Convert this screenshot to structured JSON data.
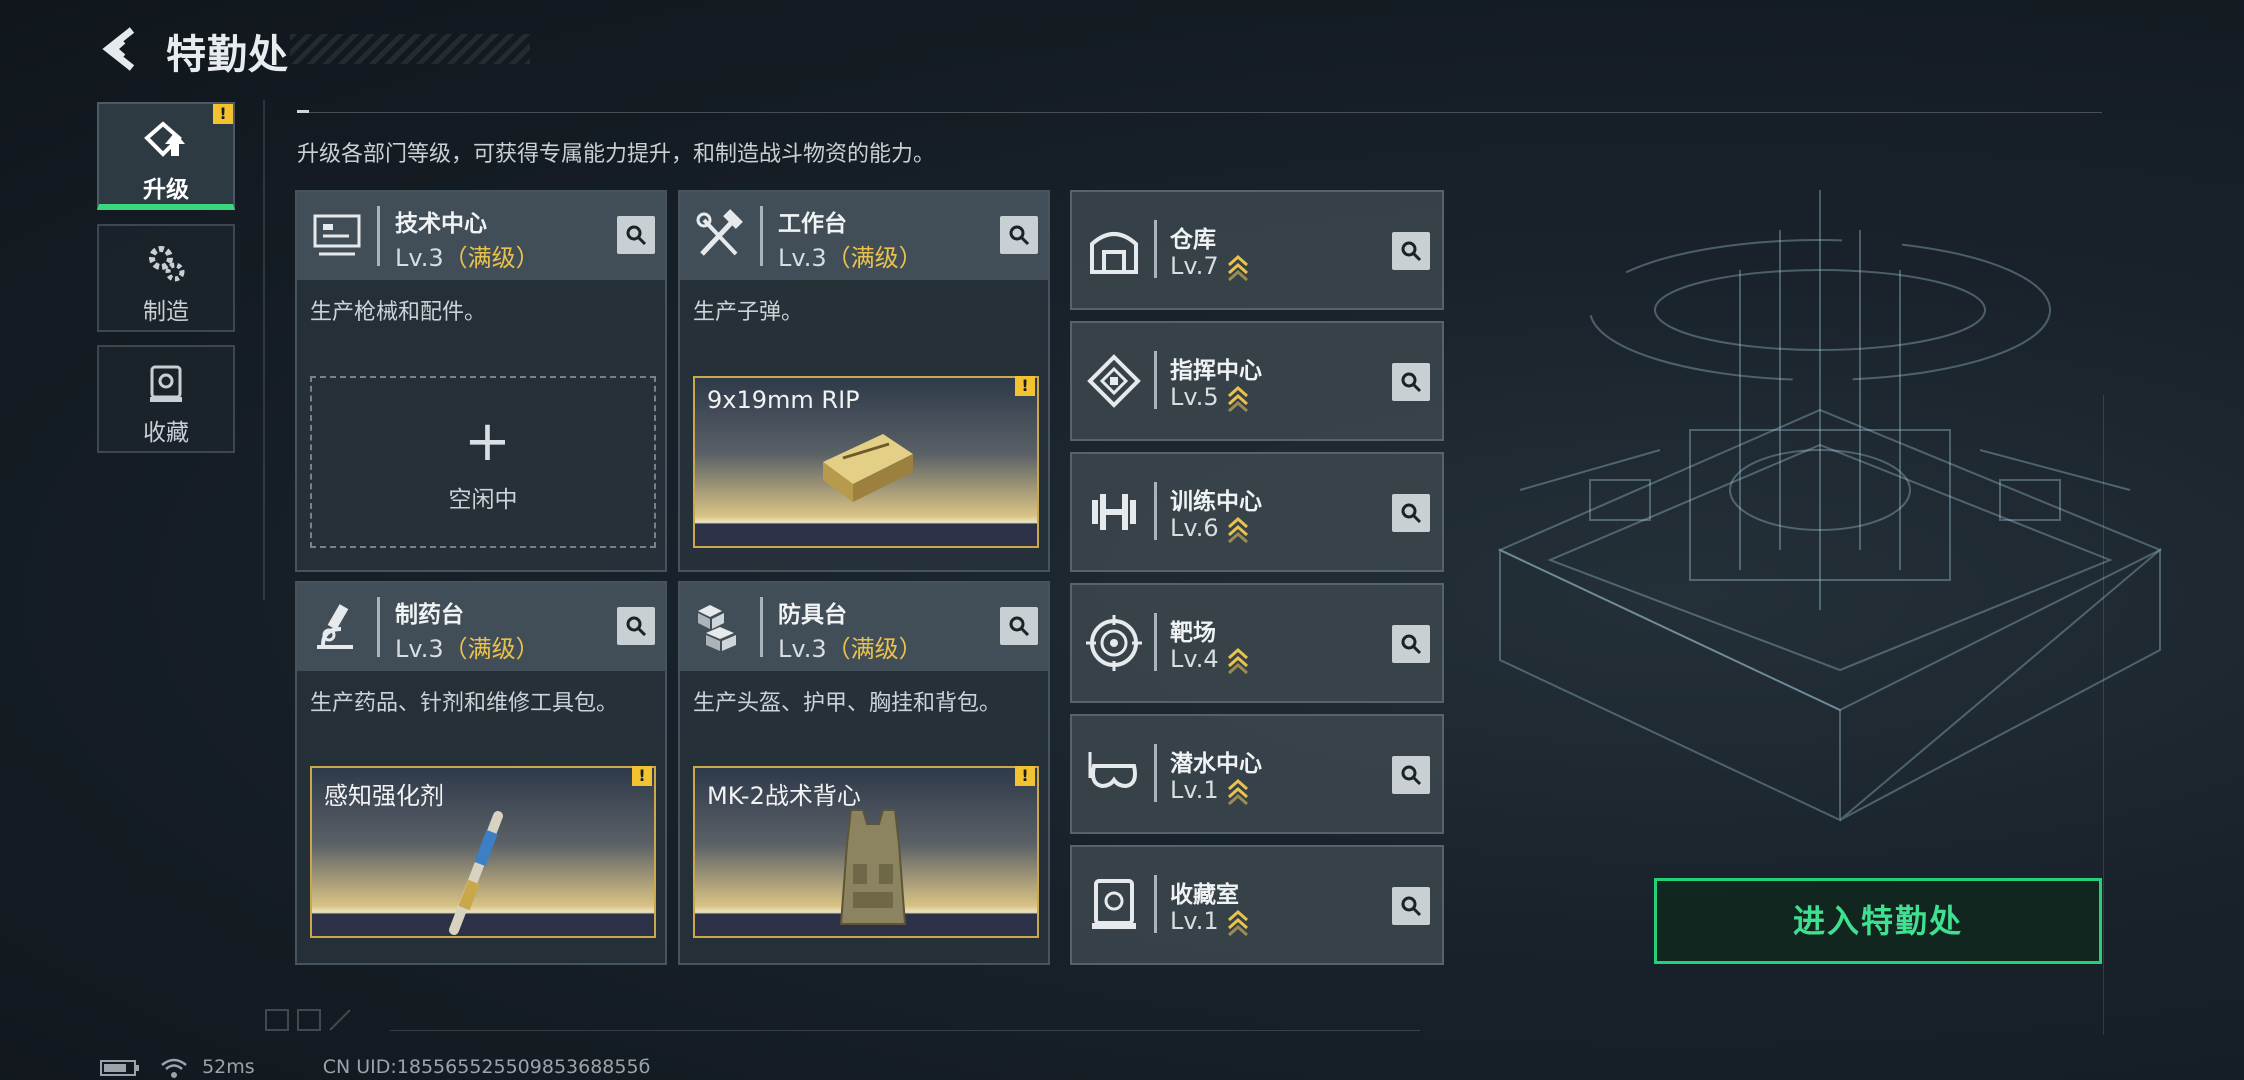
{
  "header": {
    "title": "特勤处"
  },
  "nav": [
    {
      "label": "升级",
      "icon": "upgrade-icon",
      "active": true,
      "alert": "!"
    },
    {
      "label": "制造",
      "icon": "gear-icon",
      "active": false
    },
    {
      "label": "收藏",
      "icon": "collection-icon",
      "active": false
    }
  ],
  "description": "升级各部门等级，可获得专属能力提升，和制造战斗物资的能力。",
  "workshops": [
    {
      "name": "技术中心",
      "level": "Lv.3",
      "full": "（满级）",
      "desc": "生产枪械和配件。",
      "slot": {
        "state": "idle",
        "plus": "+",
        "label": "空闲中"
      },
      "icon": "monitor-icon"
    },
    {
      "name": "工作台",
      "level": "Lv.3",
      "full": "（满级）",
      "desc": "生产子弹。",
      "slot": {
        "state": "producing",
        "item": "9x19mm RIP",
        "alert": "!"
      },
      "icon": "hammer-wrench-icon"
    },
    {
      "name": "制药台",
      "level": "Lv.3",
      "full": "（满级）",
      "desc": "生产药品、针剂和维修工具包。",
      "slot": {
        "state": "producing",
        "item": "感知强化剂",
        "alert": "!"
      },
      "icon": "microscope-icon"
    },
    {
      "name": "防具台",
      "level": "Lv.3",
      "full": "（满级）",
      "desc": "生产头盔、护甲、胸挂和背包。",
      "slot": {
        "state": "producing",
        "item": "MK-2战术背心",
        "alert": "!"
      },
      "icon": "armor-blocks-icon"
    }
  ],
  "buildings": [
    {
      "name": "仓库",
      "level": "Lv.7",
      "icon": "warehouse-icon"
    },
    {
      "name": "指挥中心",
      "level": "Lv.5",
      "icon": "command-icon"
    },
    {
      "name": "训练中心",
      "level": "Lv.6",
      "icon": "dumbbell-icon"
    },
    {
      "name": "靶场",
      "level": "Lv.4",
      "icon": "target-icon"
    },
    {
      "name": "潜水中心",
      "level": "Lv.1",
      "icon": "diving-mask-icon"
    },
    {
      "name": "收藏室",
      "level": "Lv.1",
      "icon": "collection-icon"
    }
  ],
  "enter_button": "进入特勤处",
  "footer": {
    "ping": "52ms",
    "uid": "CN UID:18556552550985368855б"
  },
  "colors": {
    "accent_green": "#24d07a",
    "warning_yellow": "#f2c230",
    "full_level": "#e9c24e"
  }
}
